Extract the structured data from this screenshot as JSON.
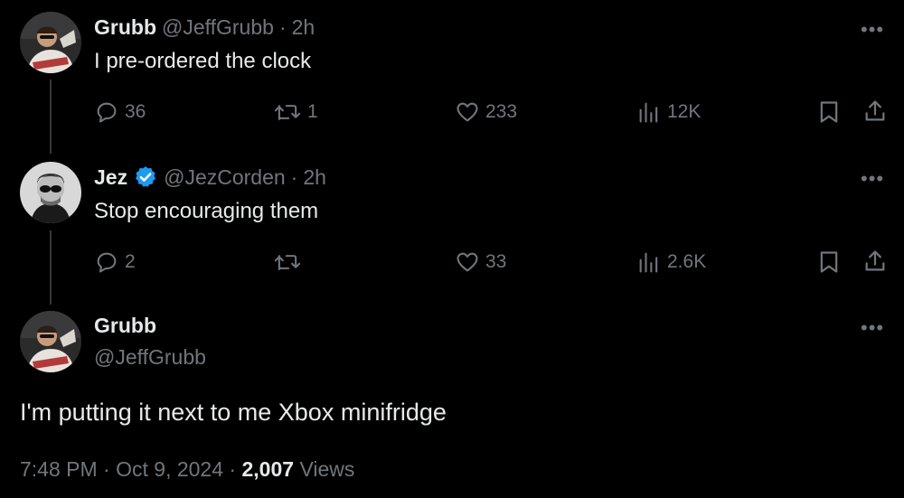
{
  "tweets": [
    {
      "name": "Grubb",
      "handle": "@JeffGrubb",
      "separator": "·",
      "time": "2h",
      "text": "I pre-ordered the clock",
      "replies": "36",
      "reposts": "1",
      "likes": "233",
      "views": "12K"
    },
    {
      "name": "Jez",
      "verified": true,
      "handle": "@JezCorden",
      "separator": "·",
      "time": "2h",
      "text": "Stop encouraging them",
      "replies": "2",
      "reposts": "",
      "likes": "33",
      "views": "2.6K"
    }
  ],
  "main_tweet": {
    "name": "Grubb",
    "handle": "@JeffGrubb",
    "text": "I'm putting it next to me Xbox minifridge",
    "time": "7:48 PM",
    "separator": "·",
    "date": "Oct 9, 2024",
    "views_count": "2,007",
    "views_label": "Views"
  },
  "icons": {
    "more": "more-horizontal-icon",
    "reply": "reply-bubble-icon",
    "repost": "repost-arrows-icon",
    "like": "heart-icon",
    "views": "bar-chart-icon",
    "bookmark": "bookmark-icon",
    "share": "share-upload-icon",
    "verified": "verified-badge-icon"
  },
  "colors": {
    "background": "#000000",
    "primary_text": "#e7e9ea",
    "secondary_text": "#71767b",
    "verified_blue": "#1d9bf0",
    "thread_line": "#333639"
  }
}
